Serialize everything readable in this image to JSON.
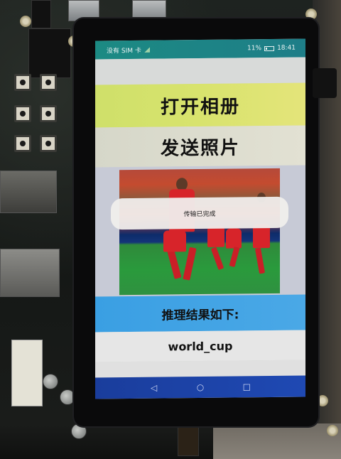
{
  "status_bar": {
    "carrier": "没有 SIM 卡",
    "battery": "11%",
    "time": "18:41"
  },
  "buttons": {
    "open_album": "打开相册",
    "send_photo": "发送照片"
  },
  "toast": {
    "message": "传输已完成"
  },
  "result": {
    "title": "推理结果如下:",
    "value": "world_cup"
  },
  "nav": {
    "back": "◁",
    "home": "○",
    "recents": "□"
  },
  "colors": {
    "status_bar": "#1c8a83",
    "open_button": "#d8e36d",
    "result_title": "#3a9fe3",
    "nav_bar": "#1a3d9c"
  }
}
